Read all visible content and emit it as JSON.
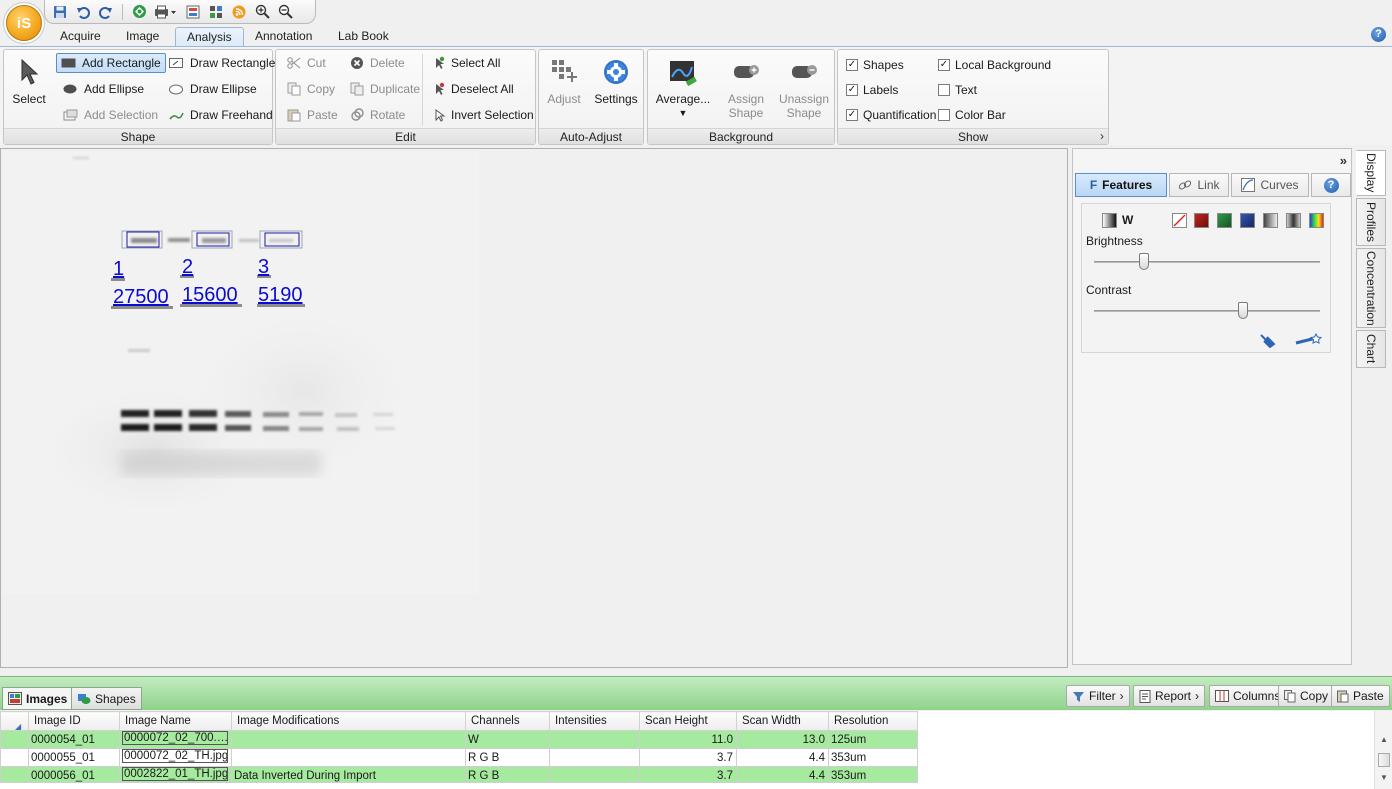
{
  "app": {
    "logo_text": "iS"
  },
  "quick_access": [
    "save-icon",
    "undo-icon",
    "redo-icon",
    "scan-icon",
    "print-icon",
    "export-icon",
    "grid-icon",
    "rss-icon",
    "zoom-in-icon",
    "zoom-out-icon"
  ],
  "tabs": [
    "Acquire",
    "Image",
    "Analysis",
    "Annotation",
    "Lab Book"
  ],
  "active_tab": "Analysis",
  "ribbon": {
    "shape": {
      "label": "Shape",
      "select": "Select",
      "add_rectangle": "Add Rectangle",
      "add_ellipse": "Add Ellipse",
      "add_selection": "Add Selection",
      "draw_rectangle": "Draw Rectangle",
      "draw_ellipse": "Draw Ellipse",
      "draw_freehand": "Draw Freehand"
    },
    "edit": {
      "label": "Edit",
      "cut": "Cut",
      "copy": "Copy",
      "paste": "Paste",
      "delete": "Delete",
      "duplicate": "Duplicate",
      "rotate": "Rotate",
      "select_all": "Select All",
      "deselect_all": "Deselect All",
      "invert_selection": "Invert Selection"
    },
    "auto_adjust": {
      "label": "Auto-Adjust",
      "adjust": "Adjust",
      "settings": "Settings"
    },
    "background": {
      "label": "Background",
      "average": "Average...",
      "assign": "Assign Shape",
      "unassign": "Unassign Shape"
    },
    "show": {
      "label": "Show",
      "items": [
        {
          "label": "Shapes",
          "checked": true
        },
        {
          "label": "Labels",
          "checked": true
        },
        {
          "label": "Quantification",
          "checked": true
        },
        {
          "label": "Local Background",
          "checked": true
        },
        {
          "label": "Text",
          "checked": false
        },
        {
          "label": "Color Bar",
          "checked": false
        }
      ]
    }
  },
  "gel": {
    "labels": [
      "1",
      "2",
      "3"
    ],
    "values": [
      "27500",
      "15600",
      "5190"
    ],
    "accent": "#0000cc"
  },
  "panel": {
    "tabs": [
      "Features",
      "Link",
      "Curves"
    ],
    "active_tab": "Features",
    "channel": "W",
    "brightness_label": "Brightness",
    "contrast_label": "Contrast",
    "brightness_value": 0.22,
    "contrast_value": 0.66,
    "side_tabs": [
      "Display",
      "Profiles",
      "Concentration",
      "Chart"
    ]
  },
  "bottom": {
    "tabs": [
      "Images",
      "Shapes"
    ],
    "active_tab": "Images",
    "tools": [
      "Filter",
      "Report",
      "Columns",
      "Copy",
      "Paste"
    ]
  },
  "table": {
    "columns": [
      "Image ID",
      "Image Name",
      "Image Modifications",
      "Channels",
      "Intensities",
      "Scan Height",
      "Scan Width",
      "Resolution"
    ],
    "rows": [
      {
        "id": "0000054_01",
        "name": "0000072_02_700.…",
        "mods": "",
        "channels": "W",
        "intensities": "",
        "height": "11.0",
        "width": "13.0",
        "res": "125um",
        "style": "g"
      },
      {
        "id": "0000055_01",
        "name": "0000072_02_TH.jpg",
        "mods": "",
        "channels": "R G B",
        "intensities": "",
        "height": "3.7",
        "width": "4.4",
        "res": "353um",
        "style": "w"
      },
      {
        "id": "0000056_01",
        "name": "0002822_01_TH.jpg",
        "mods": "Data Inverted During Import",
        "channels": "R G B",
        "intensities": "",
        "height": "3.7",
        "width": "4.4",
        "res": "353um",
        "style": "g"
      }
    ]
  }
}
